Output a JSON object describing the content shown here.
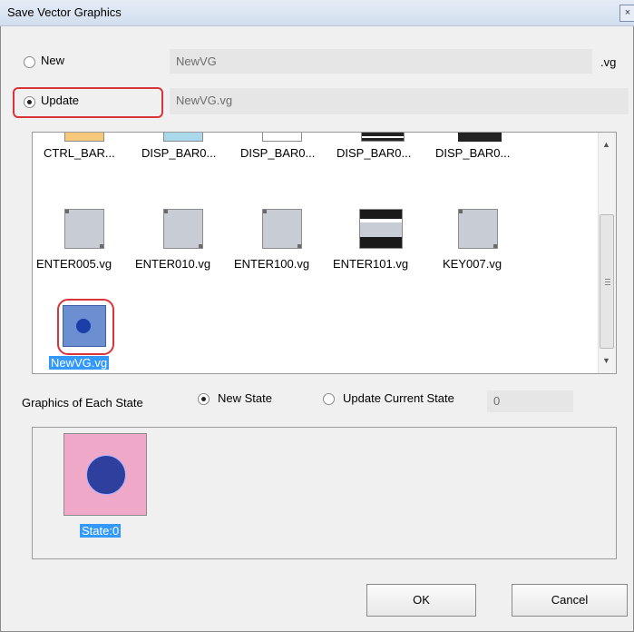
{
  "window": {
    "title": "Save Vector Graphics",
    "close_glyph": "×"
  },
  "mode": {
    "new_label": "New",
    "new_value": "NewVG",
    "extension": ".vg",
    "update_label": "Update",
    "update_value": "NewVG.vg",
    "selected": "update"
  },
  "files": {
    "row1": [
      "CTRL_BAR...",
      "DISP_BAR0...",
      "DISP_BAR0...",
      "DISP_BAR0...",
      "DISP_BAR0..."
    ],
    "row2": [
      "ENTER005.vg",
      "ENTER010.vg",
      "ENTER100.vg",
      "ENTER101.vg",
      "KEY007.vg"
    ],
    "selected": "NewVG.vg"
  },
  "states": {
    "label": "Graphics of Each State",
    "new_state_label": "New State",
    "update_current_label": "Update Current State",
    "current_value": "0",
    "selected": "new_state",
    "items": [
      "State:0"
    ]
  },
  "buttons": {
    "ok": "OK",
    "cancel": "Cancel"
  },
  "colors": {
    "highlight": "#d9343a",
    "selection": "#3399ff",
    "state_bg": "#f0a8c8",
    "state_dot": "#2f3f9e"
  }
}
